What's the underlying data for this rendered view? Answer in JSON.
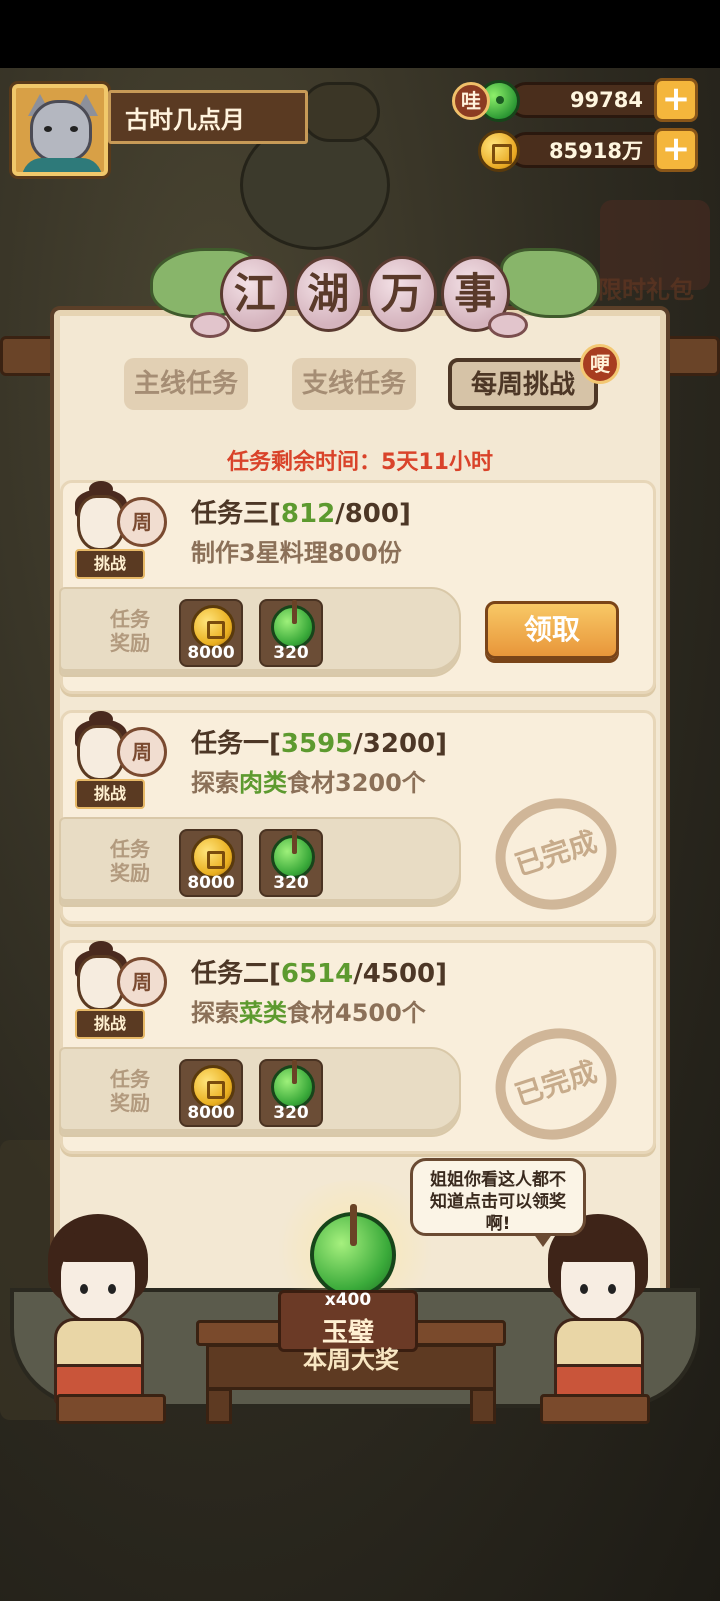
{
  "player": {
    "name": "古时几点月"
  },
  "currencies": {
    "wa_badge": "哇",
    "jade_amount": "99784",
    "coin_amount": "85918万",
    "plus": "+"
  },
  "title": {
    "chars": [
      "江",
      "湖",
      "万",
      "事"
    ]
  },
  "tabs": [
    {
      "label": "主线任务",
      "active": false
    },
    {
      "label": "支线任务",
      "active": false
    },
    {
      "label": "每周挑战",
      "active": true
    }
  ],
  "tab_badge": "哽",
  "timer_text": "任务剩余时间：5天11小时",
  "tasks": [
    {
      "name": "任务三",
      "current": "812",
      "target": "800",
      "desc_pre": "制作3星料理800份",
      "desc_hl": "",
      "desc_post": "",
      "icon_zhou": "周",
      "icon_tag": "挑战",
      "reward_label": "任务奖励",
      "reward_coin": "8000",
      "reward_jade": "320",
      "status": "claim",
      "claim_label": "领取",
      "done_label": ""
    },
    {
      "name": "任务一",
      "current": "3595",
      "target": "3200",
      "desc_pre": "探索",
      "desc_hl": "肉类",
      "desc_post": "食材3200个",
      "icon_zhou": "周",
      "icon_tag": "挑战",
      "reward_label": "任务奖励",
      "reward_coin": "8000",
      "reward_jade": "320",
      "status": "done",
      "claim_label": "",
      "done_label": "已完成"
    },
    {
      "name": "任务二",
      "current": "6514",
      "target": "4500",
      "desc_pre": "探索",
      "desc_hl": "菜类",
      "desc_post": "食材4500个",
      "icon_zhou": "周",
      "icon_tag": "挑战",
      "reward_label": "任务奖励",
      "reward_coin": "8000",
      "reward_jade": "320",
      "status": "done",
      "claim_label": "",
      "done_label": "已完成"
    }
  ],
  "weekly_prize": {
    "count": "x400",
    "name": "玉璧",
    "label": "本周大奖"
  },
  "speech_bubble": "姐姐你看这人都不知道点击可以领奖啊!",
  "background_text": "限时礼包",
  "colors": {
    "accent_green": "#5d9a2f",
    "timer_red": "#d9432a",
    "claim_orange": "#e8963a"
  }
}
